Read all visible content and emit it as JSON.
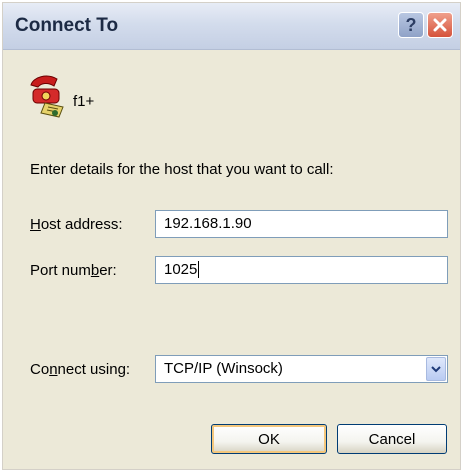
{
  "window": {
    "title": "Connect To"
  },
  "connection": {
    "name": "f1+"
  },
  "form": {
    "prompt": "Enter details for the host that you want to call:",
    "host_label_ul": "H",
    "host_label_rest": "ost address:",
    "host_value": "192.168.1.90",
    "port_label_pre": "Port num",
    "port_label_ul": "b",
    "port_label_post": "er:",
    "port_value": "1025",
    "connect_label_pre": "Co",
    "connect_label_ul": "n",
    "connect_label_post": "nect using:",
    "connect_value": "TCP/IP (Winsock)"
  },
  "buttons": {
    "ok": "OK",
    "cancel": "Cancel",
    "help": "?"
  },
  "icons": {
    "help": "help-icon",
    "close": "close-icon",
    "phone": "phone-icon",
    "dropdown": "chevron-down-icon"
  }
}
